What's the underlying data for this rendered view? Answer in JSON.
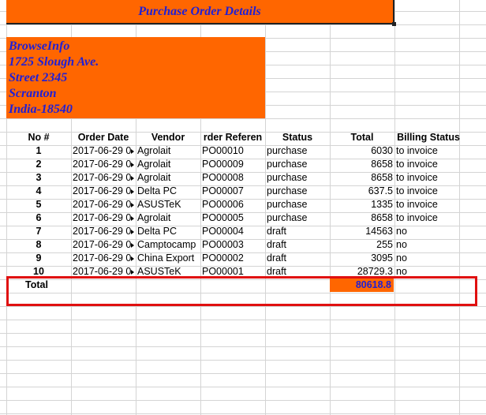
{
  "title": "Purchase Order Details",
  "company": {
    "lines": [
      "BrowseInfo",
      "1725 Slough Ave.",
      "Street 2345",
      "Scranton",
      "India-18540"
    ]
  },
  "table": {
    "headers": [
      "No #",
      "Order Date",
      "Vendor",
      "rder Referen",
      "Status",
      "Total",
      "Billing Status"
    ],
    "rows": [
      {
        "no": "1",
        "date": "2017-06-29 0",
        "vendor": "Agrolait",
        "ref": "PO00010",
        "status": "purchase",
        "total": "6030",
        "billing": "to invoice"
      },
      {
        "no": "2",
        "date": "2017-06-29 0",
        "vendor": "Agrolait",
        "ref": "PO00009",
        "status": "purchase",
        "total": "8658",
        "billing": "to invoice"
      },
      {
        "no": "3",
        "date": "2017-06-29 0",
        "vendor": "Agrolait",
        "ref": "PO00008",
        "status": "purchase",
        "total": "8658",
        "billing": "to invoice"
      },
      {
        "no": "4",
        "date": "2017-06-29 0",
        "vendor": "Delta PC",
        "ref": "PO00007",
        "status": "purchase",
        "total": "637.5",
        "billing": "to invoice"
      },
      {
        "no": "5",
        "date": "2017-06-29 0",
        "vendor": "ASUSTeK",
        "ref": "PO00006",
        "status": "purchase",
        "total": "1335",
        "billing": "to invoice"
      },
      {
        "no": "6",
        "date": "2017-06-29 0",
        "vendor": "Agrolait",
        "ref": "PO00005",
        "status": "purchase",
        "total": "8658",
        "billing": "to invoice"
      },
      {
        "no": "7",
        "date": "2017-06-29 0",
        "vendor": "Delta PC",
        "ref": "PO00004",
        "status": "draft",
        "total": "14563",
        "billing": "no"
      },
      {
        "no": "8",
        "date": "2017-06-29 0",
        "vendor": "Camptocamp",
        "ref": "PO00003",
        "status": "draft",
        "total": "255",
        "billing": "no"
      },
      {
        "no": "9",
        "date": "2017-06-29 0",
        "vendor": "China Export",
        "ref": "PO00002",
        "status": "draft",
        "total": "3095",
        "billing": "no"
      },
      {
        "no": "10",
        "date": "2017-06-29 0",
        "vendor": "ASUSTeK",
        "ref": "PO00001",
        "status": "draft",
        "total": "28729.3",
        "billing": "no"
      }
    ],
    "total_label": "Total",
    "grand_total": "80618.8"
  },
  "colors": {
    "accent_orange": "#ff6600",
    "text_blue": "#1f1fd6",
    "highlight_red": "#e01010"
  }
}
